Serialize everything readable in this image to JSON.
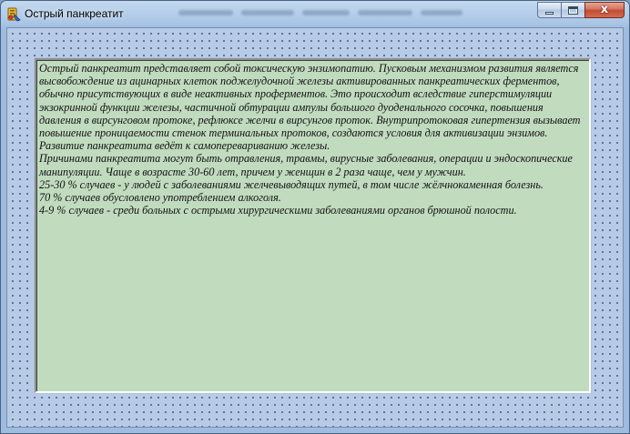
{
  "window": {
    "title": "Острый панкреатит",
    "icon": "application-icon",
    "controls": {
      "minimize": "minimize-icon",
      "maximize": "maximize-icon",
      "close_glyph": "x",
      "close": "close-icon"
    }
  },
  "colors": {
    "client_background": "#b7cbe8",
    "grid_dots": "#1d2333",
    "memo_background": "#c1dbbf",
    "close_button": "#c24a33"
  },
  "memo": {
    "text": "Острый панкреатит представляет собой токсическую энзимопатию. Пусковым механизмом развития является высвобождение из ацинарных клеток поджелудочной железы активированных панкреатических ферментов, обычно присутствующих в виде неактивных проферментов. Это происходит вследствие гиперстимуляции экзокринной функции железы, частичной обтурации ампулы большого дуоденального сосочка, повышения давления в вирсунговом протоке, рефлюксе желчи в вирсунгов проток. Внутрипротоковая гипертензия вызывает повышение проницаемости стенок терминальных протоков, создаются условия для активизации энзимов. Развитие панкреатита ведёт к самоперевариванию железы.\nПричинами панкреатита могут быть отравления, травмы, вирусные заболевания, операции и эндоскопические манипуляции. Чаще в возрасте 30-60 лет, причем у женщин в 2 раза чаще, чем у мужчин.\n25-30 % случаев - у людей с заболеваниями желчевыводящих путей, в том числе жёлчнокаменная болезнь.\n70 % случаев обусловлено употреблением алкоголя.\n4-9 % случаев - среди больных с острыми хирургическими заболеваниями органов брюшной полости."
  }
}
